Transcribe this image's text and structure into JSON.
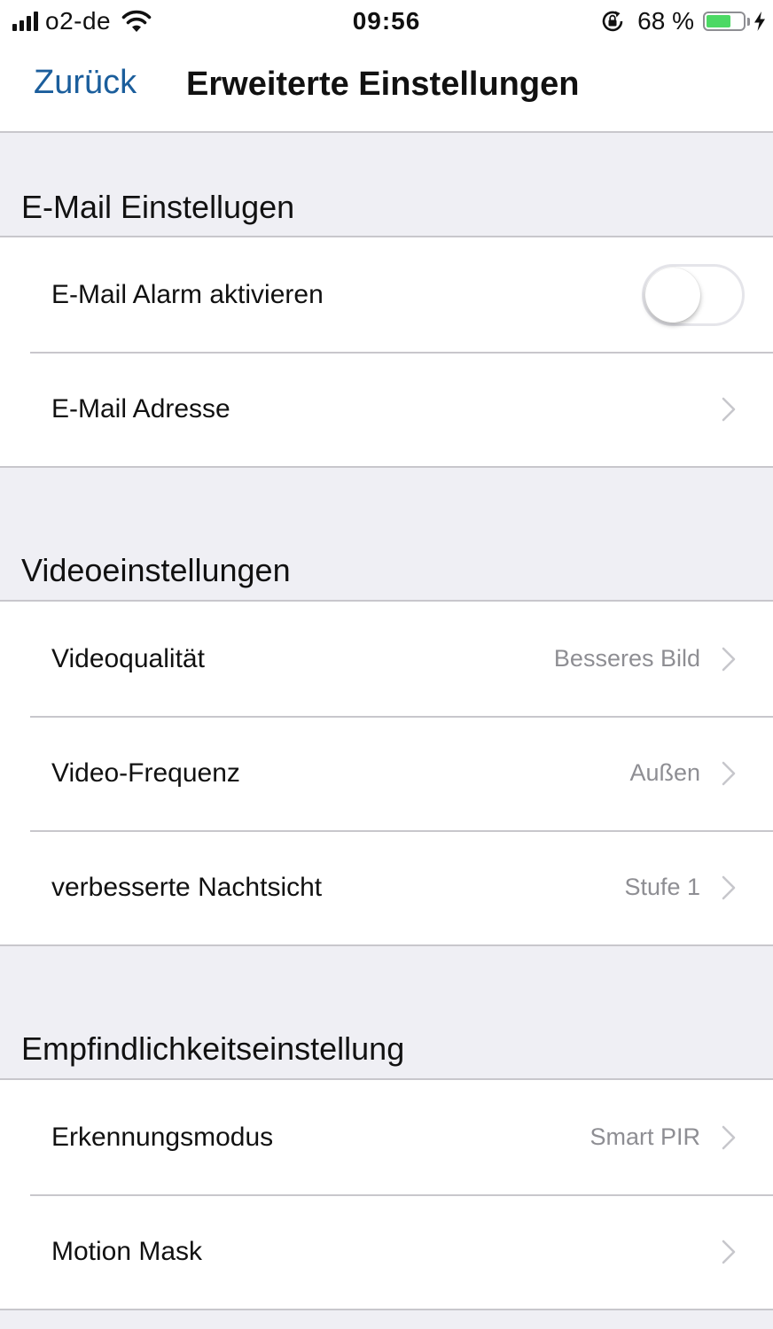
{
  "status_bar": {
    "carrier": "o2-de",
    "time": "09:56",
    "battery_percent": "68 %",
    "battery_level": 0.68,
    "battery_color": "#4cd964",
    "icons": [
      "signal-icon",
      "wifi-icon",
      "rotation-lock-icon",
      "battery-icon",
      "charging-bolt-icon"
    ]
  },
  "nav": {
    "back_label": "Zurück",
    "title": "Erweiterte Einstellungen",
    "accent_color": "#1b5e9c"
  },
  "sections": [
    {
      "header": "E-Mail Einstellugen",
      "rows": [
        {
          "label": "E-Mail Alarm aktivieren",
          "control": "toggle",
          "toggle_on": false
        },
        {
          "label": "E-Mail Adresse",
          "value": "",
          "icon": "chevron-right-icon"
        }
      ]
    },
    {
      "header": "Videoeinstellungen",
      "rows": [
        {
          "label": "Videoqualität",
          "value": "Besseres Bild",
          "icon": "chevron-right-icon"
        },
        {
          "label": "Video-Frequenz",
          "value": "Außen",
          "icon": "chevron-right-icon"
        },
        {
          "label": "verbesserte Nachtsicht",
          "value": "Stufe 1",
          "icon": "chevron-right-icon"
        }
      ]
    },
    {
      "header": "Empfindlichkeitseinstellung",
      "rows": [
        {
          "label": "Erkennungsmodus",
          "value": "Smart PIR",
          "icon": "chevron-right-icon"
        },
        {
          "label": "Motion Mask",
          "value": "",
          "icon": "chevron-right-icon"
        }
      ]
    }
  ]
}
